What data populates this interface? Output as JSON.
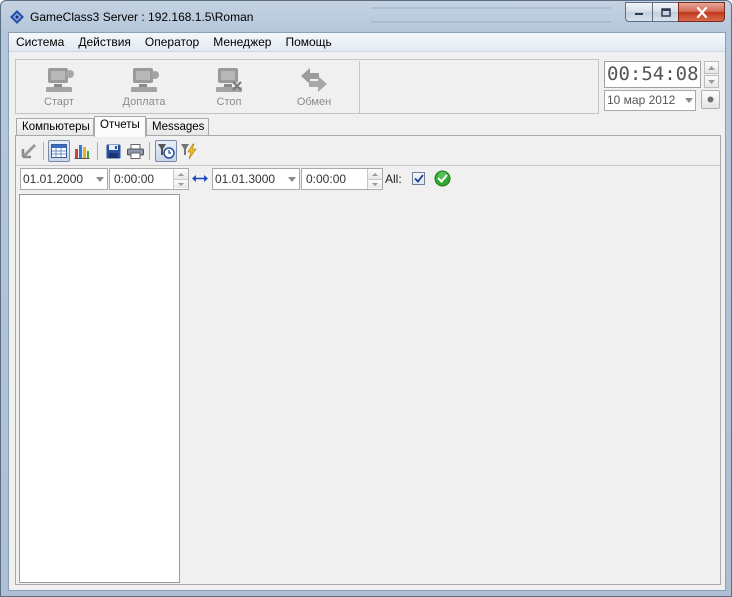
{
  "window": {
    "title": "GameClass3 Server : 192.168.1.5\\Roman"
  },
  "menu": {
    "items": [
      "Система",
      "Действия",
      "Оператор",
      "Менеджер",
      "Помощь"
    ]
  },
  "toolbar": {
    "buttons": [
      {
        "label": "Старт",
        "icon": "computer-start-icon"
      },
      {
        "label": "Доплата",
        "icon": "computer-add-payment-icon"
      },
      {
        "label": "Стоп",
        "icon": "computer-stop-icon"
      },
      {
        "label": "Обмен",
        "icon": "exchange-arrows-icon"
      }
    ]
  },
  "clock": {
    "time": "00:54:08",
    "date": "10 мар 2012"
  },
  "tabs": [
    {
      "label": "Компьютеры",
      "active": false
    },
    {
      "label": "Отчеты",
      "active": true
    },
    {
      "label": "Messages",
      "active": false
    }
  ],
  "reports": {
    "toolbar_icons": [
      "export-arrow-icon",
      "table-view-icon",
      "chart-view-icon",
      "save-icon",
      "print-icon",
      "filter-time-icon",
      "lightning-filter-icon"
    ],
    "filter": {
      "date_from": "01.01.2000",
      "time_from": "0:00:00",
      "date_to": "01.01.3000",
      "time_to": "0:00:00",
      "all_label": "All:",
      "all_checked": true
    }
  },
  "colors": {
    "accent_blue": "#1f4fbf",
    "apply_green": "#2faa2f",
    "close_red": "#c0381c"
  }
}
